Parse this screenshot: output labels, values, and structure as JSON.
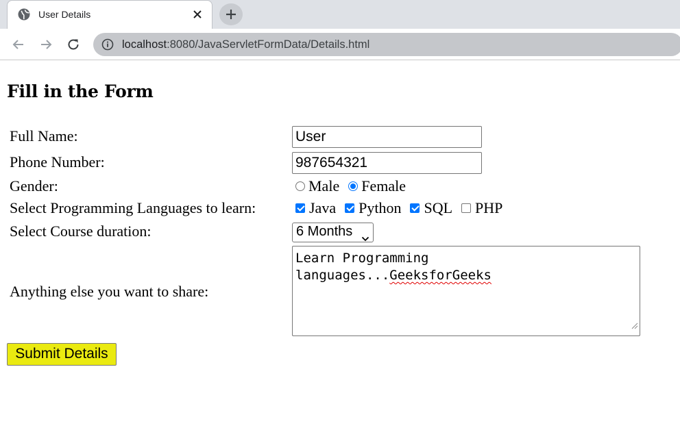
{
  "browser": {
    "tab_title": "User Details",
    "url_host": "localhost",
    "url_rest": ":8080/JavaServletFormData/Details.html",
    "icons": [
      "globe-icon",
      "close-icon",
      "plus-icon",
      "back-arrow-icon",
      "forward-arrow-icon",
      "reload-icon",
      "info-icon"
    ]
  },
  "form": {
    "heading": "Fill in the Form",
    "full_name": {
      "label": "Full Name:",
      "value": "User"
    },
    "phone": {
      "label": "Phone Number:",
      "value": "987654321"
    },
    "gender": {
      "label": "Gender:",
      "options": [
        {
          "label": "Male",
          "checked": false
        },
        {
          "label": "Female",
          "checked": true
        }
      ]
    },
    "languages": {
      "label": "Select Programming Languages to learn:",
      "options": [
        {
          "label": "Java",
          "checked": true
        },
        {
          "label": "Python",
          "checked": true
        },
        {
          "label": "SQL",
          "checked": true
        },
        {
          "label": "PHP",
          "checked": false
        }
      ]
    },
    "duration": {
      "label": "Select Course duration:",
      "selected": "6 Months"
    },
    "share": {
      "label": "Anything else you want to share:",
      "text_part1": "Learn Programming\nlanguages...",
      "text_part2": "GeeksforGeeks"
    },
    "submit_label": "Submit Details"
  },
  "colors": {
    "submit_bg": "#eaea10",
    "checked_blue": "#0075ff",
    "spellcheck_red": "#e00000"
  }
}
